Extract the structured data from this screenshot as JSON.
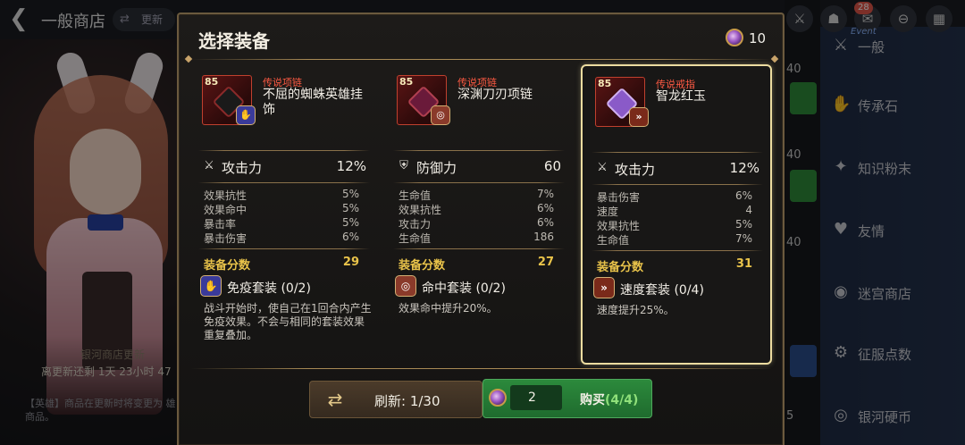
{
  "background": {
    "title": "一般商店",
    "refresh_label": "更新",
    "galaxy_label": "银河商店更新",
    "countdown": "离更新还剩 1天 23小时 47",
    "note": "【英雄】商品在更新时将变更为 雄商品。",
    "right_numbers": [
      "40",
      "40",
      "40",
      "5"
    ],
    "mail_badge": "28",
    "event_label": "Event",
    "sidebar": [
      {
        "label": "一般",
        "icon": "sword-icon"
      },
      {
        "label": "传承石",
        "icon": "stone-icon"
      },
      {
        "label": "知识粉末",
        "icon": "powder-icon"
      },
      {
        "label": "友情",
        "icon": "heart-icon"
      },
      {
        "label": "迷宫商店",
        "icon": "maze-icon"
      },
      {
        "label": "征服点数",
        "icon": "conquest-icon"
      },
      {
        "label": "银河硬币",
        "icon": "galaxy-coin-icon"
      }
    ]
  },
  "dialog": {
    "title": "选择装备",
    "currency": "10",
    "cards": [
      {
        "level": "85",
        "grade": "传说项链",
        "name": "不屈的蜘蛛英雄挂饰",
        "main_stat": {
          "label": "攻击力",
          "value": "12%",
          "icon": "sword-icon"
        },
        "sub_stats": [
          {
            "label": "效果抗性",
            "value": "5%"
          },
          {
            "label": "效果命中",
            "value": "5%"
          },
          {
            "label": "暴击率",
            "value": "5%"
          },
          {
            "label": "暴击伤害",
            "value": "6%"
          }
        ],
        "score_label": "装备分数",
        "score": "29",
        "set_name": "免疫套装",
        "set_count": "(0/2)",
        "set_desc": "战斗开始时，使自己在1回合内产生免疫效果。不会与相同的套装效果重复叠加。",
        "selected": false,
        "set_color": "#3a3a9a",
        "gem_color": "#3a1010"
      },
      {
        "level": "85",
        "grade": "传说项链",
        "name": "深渊刀刃项链",
        "main_stat": {
          "label": "防御力",
          "value": "60",
          "icon": "shield-icon"
        },
        "sub_stats": [
          {
            "label": "生命值",
            "value": "7%"
          },
          {
            "label": "效果抗性",
            "value": "6%"
          },
          {
            "label": "攻击力",
            "value": "6%"
          },
          {
            "label": "生命值",
            "value": "186"
          }
        ],
        "score_label": "装备分数",
        "score": "27",
        "set_name": "命中套装",
        "set_count": "(0/2)",
        "set_desc": "效果命中提升20%。",
        "selected": false,
        "set_color": "#8a3a2a",
        "gem_color": "#6a1a3a"
      },
      {
        "level": "85",
        "grade": "传说戒指",
        "name": "智龙红玉",
        "main_stat": {
          "label": "攻击力",
          "value": "12%",
          "icon": "sword-icon"
        },
        "sub_stats": [
          {
            "label": "暴击伤害",
            "value": "6%"
          },
          {
            "label": "速度",
            "value": "4"
          },
          {
            "label": "效果抗性",
            "value": "5%"
          },
          {
            "label": "生命值",
            "value": "7%"
          }
        ],
        "score_label": "装备分数",
        "score": "31",
        "set_name": "速度套装",
        "set_count": "(0/4)",
        "set_desc": "速度提升25%。",
        "selected": true,
        "set_color": "#7a2a1a",
        "gem_color": "#8a5ac8"
      }
    ],
    "refresh_label": "刷新: 1/30",
    "price": "2",
    "buy_label": "购买",
    "buy_count": "(4/4)"
  }
}
